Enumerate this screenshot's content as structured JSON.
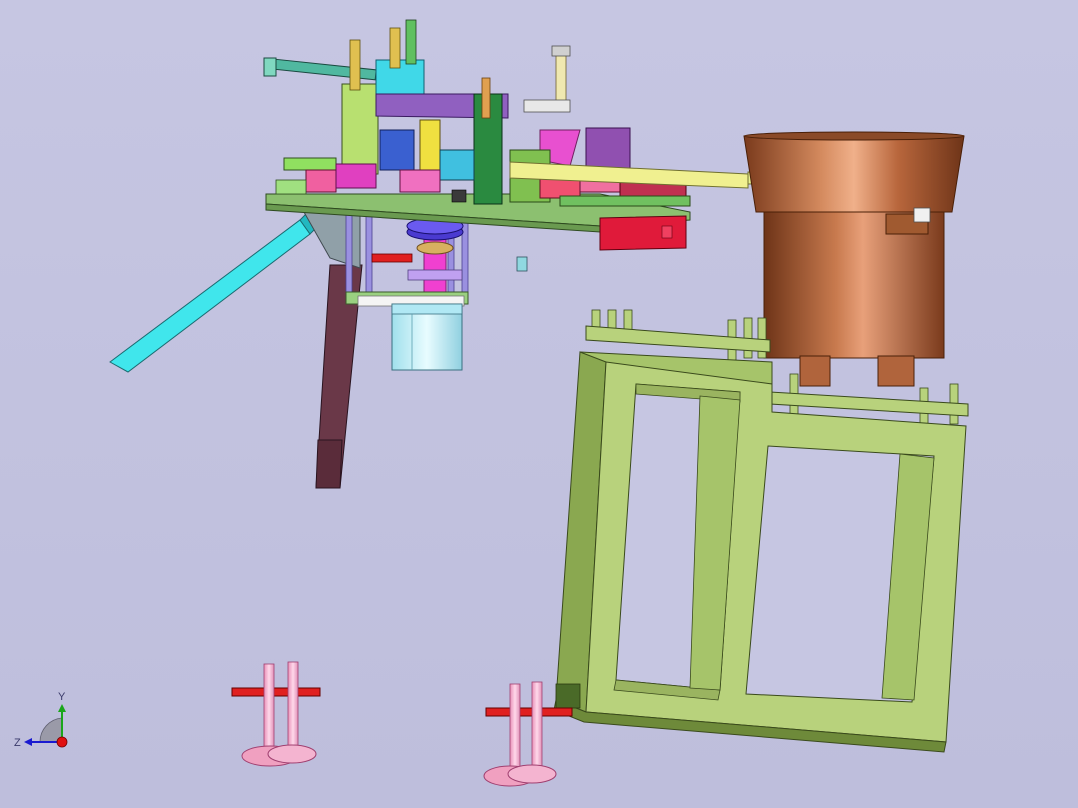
{
  "viewport": {
    "background": "#c4c4e0"
  },
  "triad": {
    "x_label": "",
    "y_label": "Y",
    "z_label": "Z",
    "y_color": "#1aa61a",
    "z_color": "#1a1ad0",
    "origin_color": "#e01010"
  },
  "model_colors": {
    "bowl": "#b0643c",
    "frame": "#b8d27c",
    "plate": "#8cc070",
    "chute": "#40e0e8",
    "feet": "#f0a0c0",
    "feet_bar": "#e02020",
    "column": "#6a3a48",
    "cylinder": "#c0f0f8",
    "magenta": "#e040c0",
    "purple": "#8a5ab0",
    "red_block": "#e02040"
  }
}
